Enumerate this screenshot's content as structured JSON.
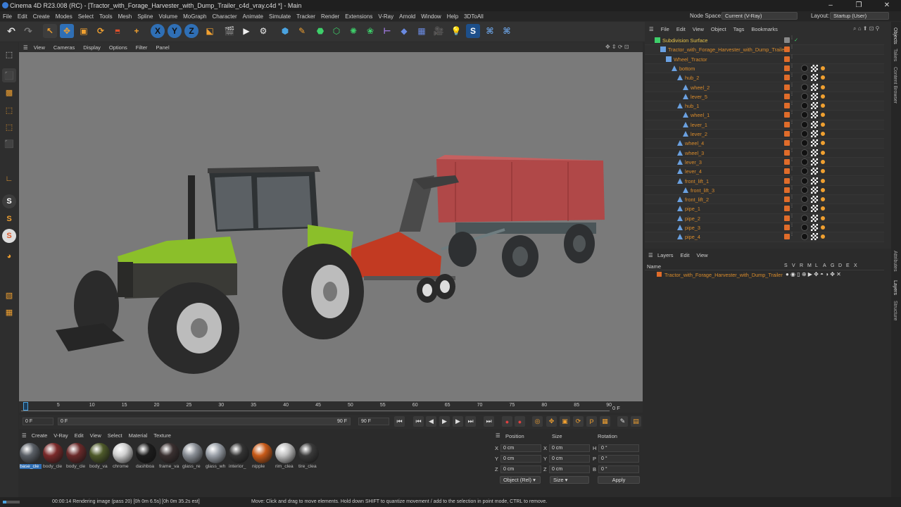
{
  "window": {
    "title": "Cinema 4D R23.008 (RC) - [Tractor_with_Forage_Harvester_with_Dump_Trailer_c4d_vray.c4d *] - Main"
  },
  "menu": [
    "File",
    "Edit",
    "Create",
    "Modes",
    "Select",
    "Tools",
    "Mesh",
    "Spline",
    "Volume",
    "MoGraph",
    "Character",
    "Animate",
    "Simulate",
    "Tracker",
    "Render",
    "Extensions",
    "V-Ray",
    "Arnold",
    "Window",
    "Help",
    "3DToAll"
  ],
  "node_space": {
    "label": "Node Space:",
    "value": "Current (V-Ray)"
  },
  "layout": {
    "label": "Layout:",
    "value": "Startup (User)"
  },
  "viewport_menu": [
    "View",
    "Cameras",
    "Display",
    "Options",
    "Filter",
    "Panel"
  ],
  "timeline": {
    "ticks": [
      "0",
      "5",
      "10",
      "15",
      "20",
      "25",
      "30",
      "35",
      "40",
      "45",
      "50",
      "55",
      "60",
      "65",
      "70",
      "75",
      "80",
      "85",
      "90"
    ],
    "current": "0 F",
    "start": "0 F",
    "range_start": "0 F",
    "range_end": "90 F",
    "end": "90 F"
  },
  "materials": {
    "menu": [
      "Create",
      "V-Ray",
      "Edit",
      "View",
      "Select",
      "Material",
      "Texture"
    ],
    "items": [
      {
        "label": "base_cle",
        "color": "#5a5f66"
      },
      {
        "label": "body_cle",
        "color": "#7a2a2a"
      },
      {
        "label": "body_cle",
        "color": "#6a2a2a"
      },
      {
        "label": "body_va",
        "color": "#4e5a2a"
      },
      {
        "label": "chrome",
        "color": "#d0d0d0"
      },
      {
        "label": "dashboa",
        "color": "#1c1c1c"
      },
      {
        "label": "frame_va",
        "color": "#3a3030"
      },
      {
        "label": "glass_re",
        "color": "#8a8f96"
      },
      {
        "label": "glass_wh",
        "color": "#9aa0a8"
      },
      {
        "label": "interior_",
        "color": "#333333"
      },
      {
        "label": "nipple",
        "color": "#c85a18"
      },
      {
        "label": "rim_clea",
        "color": "#c0c0c0"
      },
      {
        "label": "tire_clea",
        "color": "#3a3a3a"
      }
    ]
  },
  "coords": {
    "headers": {
      "position": "Position",
      "size": "Size",
      "rotation": "Rotation"
    },
    "rows": [
      {
        "axis": "X",
        "pos": "0 cm",
        "saxis": "X",
        "size": "0 cm",
        "raxis": "H",
        "rot": "0 °"
      },
      {
        "axis": "Y",
        "pos": "0 cm",
        "saxis": "Y",
        "size": "0 cm",
        "raxis": "P",
        "rot": "0 °"
      },
      {
        "axis": "Z",
        "pos": "0 cm",
        "saxis": "Z",
        "size": "0 cm",
        "raxis": "B",
        "rot": "0 °"
      }
    ],
    "mode": "Object (Rel)",
    "size_mode": "Size",
    "apply": "Apply"
  },
  "status": {
    "render": "00:00:14 Rendering image (pass 20) [0h  0m  6.5s] [0h  0m 35.2s est]",
    "hint": "Move: Click and drag to move elements. Hold down SHIFT to quantize movement / add to the selection in point mode, CTRL to remove."
  },
  "objects": {
    "menu": [
      "File",
      "Edit",
      "View",
      "Object",
      "Tags",
      "Bookmarks"
    ],
    "items": [
      {
        "name": "Subdivision Surface",
        "indent": 0
      },
      {
        "name": "Tractor_with_Forage_Harvester_with_Dump_Trailer",
        "indent": 1
      },
      {
        "name": "Wheel_Tractor",
        "indent": 2
      },
      {
        "name": "bottom",
        "indent": 3
      },
      {
        "name": "hub_2",
        "indent": 4
      },
      {
        "name": "wheel_2",
        "indent": 5
      },
      {
        "name": "lever_5",
        "indent": 5
      },
      {
        "name": "hub_1",
        "indent": 4
      },
      {
        "name": "wheel_1",
        "indent": 5
      },
      {
        "name": "lever_1",
        "indent": 5
      },
      {
        "name": "lever_2",
        "indent": 5
      },
      {
        "name": "wheel_4",
        "indent": 4
      },
      {
        "name": "wheel_3",
        "indent": 4
      },
      {
        "name": "lever_3",
        "indent": 4
      },
      {
        "name": "lever_4",
        "indent": 4
      },
      {
        "name": "front_lift_1",
        "indent": 4
      },
      {
        "name": "front_lift_3",
        "indent": 5
      },
      {
        "name": "front_lift_2",
        "indent": 4
      },
      {
        "name": "pipe_1",
        "indent": 4
      },
      {
        "name": "pipe_2",
        "indent": 4
      },
      {
        "name": "pipe_3",
        "indent": 4
      },
      {
        "name": "pipe_4",
        "indent": 4
      }
    ]
  },
  "layers": {
    "menu": [
      "Layers",
      "Edit",
      "View"
    ],
    "name_header": "Name",
    "flags": [
      "S",
      "V",
      "R",
      "M",
      "L",
      "A",
      "G",
      "D",
      "E",
      "X"
    ],
    "items": [
      {
        "name": "Tractor_with_Forage_Harvester_with_Dump_Trailer"
      }
    ]
  },
  "side_tabs": [
    "Objects",
    "Takes",
    "Content Browser",
    "Attributes",
    "Layers",
    "Structure"
  ]
}
